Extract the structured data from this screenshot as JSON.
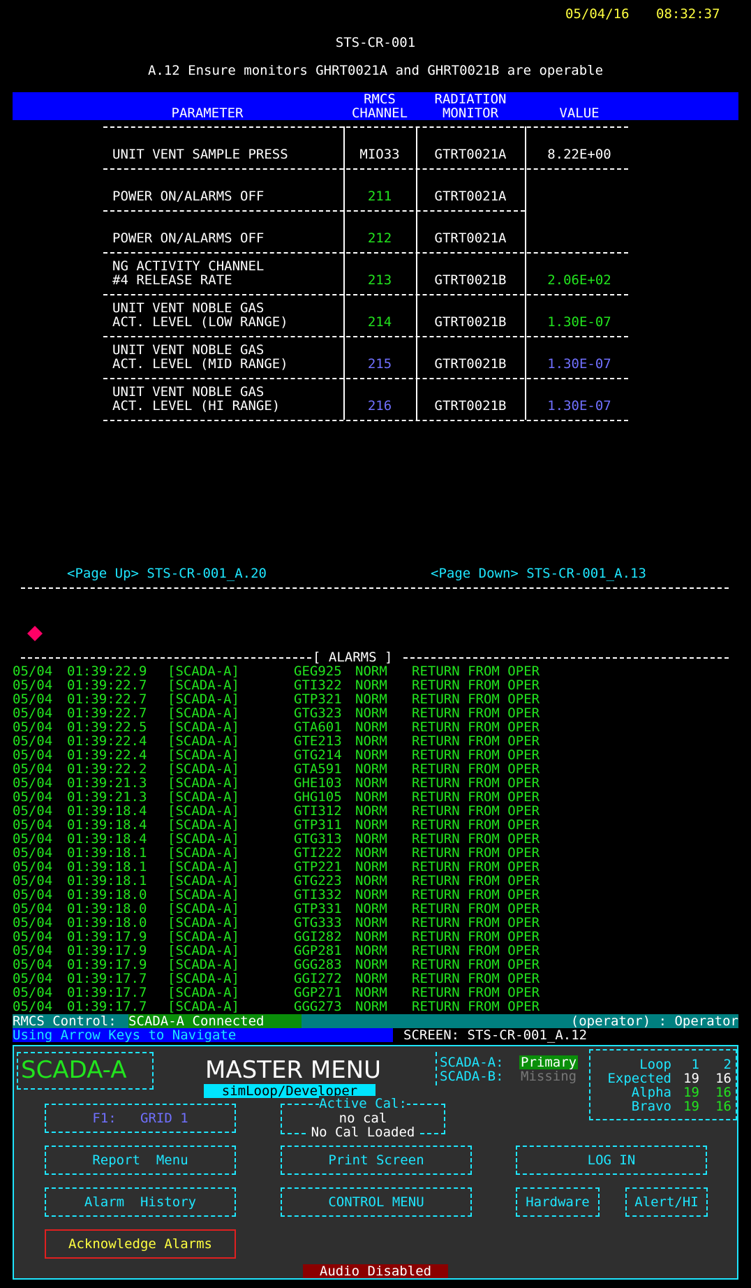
{
  "datetime": {
    "date": "05/04/16",
    "time": "08:32:37"
  },
  "screen_id": "STS-CR-001",
  "subtitle": "A.12 Ensure monitors GHRT0021A and GHRT0021B are operable",
  "table": {
    "headers": {
      "parameter": "PARAMETER",
      "rmcs_line1": "RMCS",
      "rmcs_line2": "CHANNEL",
      "rad_line1": "RADIATION",
      "rad_line2": "MONITOR",
      "value": "VALUE"
    },
    "rows": [
      {
        "param1": "UNIT VENT SAMPLE PRESS",
        "param2": "",
        "channel": "MIO33",
        "monitor": "GTRT0021A",
        "value": "8.22E+00",
        "color": "#ffffff"
      },
      {
        "param1": "POWER ON/ALARMS OFF",
        "param2": "",
        "channel": "211",
        "monitor": "GTRT0021A",
        "value": "",
        "color": "#22e41e"
      },
      {
        "param1": "POWER ON/ALARMS OFF",
        "param2": "",
        "channel": "212",
        "monitor": "GTRT0021A",
        "value": "",
        "color": "#22e41e"
      },
      {
        "param1": "NG ACTIVITY CHANNEL",
        "param2": "#4 RELEASE RATE",
        "channel": "213",
        "monitor": "GTRT0021B",
        "value": "2.06E+02",
        "color": "#22e41e"
      },
      {
        "param1": "UNIT VENT NOBLE GAS",
        "param2": "ACT. LEVEL (LOW RANGE)",
        "channel": "214",
        "monitor": "GTRT0021B",
        "value": "1.30E-07",
        "color": "#22e41e"
      },
      {
        "param1": "UNIT VENT NOBLE GAS",
        "param2": "ACT. LEVEL (MID RANGE)",
        "channel": "215",
        "monitor": "GTRT0021B",
        "value": "1.30E-07",
        "color": "#7070ff"
      },
      {
        "param1": "UNIT VENT NOBLE GAS",
        "param2": "ACT. LEVEL (HI RANGE)",
        "channel": "216",
        "monitor": "GTRT0021B",
        "value": "1.30E-07",
        "color": "#7070ff"
      }
    ]
  },
  "paging": {
    "page_up_key": "<Page Up>",
    "page_up_target": "STS-CR-001_A.20",
    "page_down_key": "<Page Down>",
    "page_down_target": "STS-CR-001_A.13"
  },
  "alarms": {
    "title": "[ ALARMS ]",
    "rows": [
      {
        "date": "05/04",
        "time": "01:39:22.9",
        "source": "[SCADA-A]",
        "point": "GEG925",
        "state": "NORM",
        "msg": "RETURN FROM OPER"
      },
      {
        "date": "05/04",
        "time": "01:39:22.7",
        "source": "[SCADA-A]",
        "point": "GTI322",
        "state": "NORM",
        "msg": "RETURN FROM OPER"
      },
      {
        "date": "05/04",
        "time": "01:39:22.7",
        "source": "[SCADA-A]",
        "point": "GTP321",
        "state": "NORM",
        "msg": "RETURN FROM OPER"
      },
      {
        "date": "05/04",
        "time": "01:39:22.7",
        "source": "[SCADA-A]",
        "point": "GTG323",
        "state": "NORM",
        "msg": "RETURN FROM OPER"
      },
      {
        "date": "05/04",
        "time": "01:39:22.5",
        "source": "[SCADA-A]",
        "point": "GTA601",
        "state": "NORM",
        "msg": "RETURN FROM OPER"
      },
      {
        "date": "05/04",
        "time": "01:39:22.4",
        "source": "[SCADA-A]",
        "point": "GTE213",
        "state": "NORM",
        "msg": "RETURN FROM OPER"
      },
      {
        "date": "05/04",
        "time": "01:39:22.4",
        "source": "[SCADA-A]",
        "point": "GTG214",
        "state": "NORM",
        "msg": "RETURN FROM OPER"
      },
      {
        "date": "05/04",
        "time": "01:39:22.2",
        "source": "[SCADA-A]",
        "point": "GTA591",
        "state": "NORM",
        "msg": "RETURN FROM OPER"
      },
      {
        "date": "05/04",
        "time": "01:39:21.3",
        "source": "[SCADA-A]",
        "point": "GHE103",
        "state": "NORM",
        "msg": "RETURN FROM OPER"
      },
      {
        "date": "05/04",
        "time": "01:39:21.3",
        "source": "[SCADA-A]",
        "point": "GHG105",
        "state": "NORM",
        "msg": "RETURN FROM OPER"
      },
      {
        "date": "05/04",
        "time": "01:39:18.4",
        "source": "[SCADA-A]",
        "point": "GTI312",
        "state": "NORM",
        "msg": "RETURN FROM OPER"
      },
      {
        "date": "05/04",
        "time": "01:39:18.4",
        "source": "[SCADA-A]",
        "point": "GTP311",
        "state": "NORM",
        "msg": "RETURN FROM OPER"
      },
      {
        "date": "05/04",
        "time": "01:39:18.4",
        "source": "[SCADA-A]",
        "point": "GTG313",
        "state": "NORM",
        "msg": "RETURN FROM OPER"
      },
      {
        "date": "05/04",
        "time": "01:39:18.1",
        "source": "[SCADA-A]",
        "point": "GTI222",
        "state": "NORM",
        "msg": "RETURN FROM OPER"
      },
      {
        "date": "05/04",
        "time": "01:39:18.1",
        "source": "[SCADA-A]",
        "point": "GTP221",
        "state": "NORM",
        "msg": "RETURN FROM OPER"
      },
      {
        "date": "05/04",
        "time": "01:39:18.1",
        "source": "[SCADA-A]",
        "point": "GTG223",
        "state": "NORM",
        "msg": "RETURN FROM OPER"
      },
      {
        "date": "05/04",
        "time": "01:39:18.0",
        "source": "[SCADA-A]",
        "point": "GTI332",
        "state": "NORM",
        "msg": "RETURN FROM OPER"
      },
      {
        "date": "05/04",
        "time": "01:39:18.0",
        "source": "[SCADA-A]",
        "point": "GTP331",
        "state": "NORM",
        "msg": "RETURN FROM OPER"
      },
      {
        "date": "05/04",
        "time": "01:39:18.0",
        "source": "[SCADA-A]",
        "point": "GTG333",
        "state": "NORM",
        "msg": "RETURN FROM OPER"
      },
      {
        "date": "05/04",
        "time": "01:39:17.9",
        "source": "[SCADA-A]",
        "point": "GGI282",
        "state": "NORM",
        "msg": "RETURN FROM OPER"
      },
      {
        "date": "05/04",
        "time": "01:39:17.9",
        "source": "[SCADA-A]",
        "point": "GGP281",
        "state": "NORM",
        "msg": "RETURN FROM OPER"
      },
      {
        "date": "05/04",
        "time": "01:39:17.9",
        "source": "[SCADA-A]",
        "point": "GGG283",
        "state": "NORM",
        "msg": "RETURN FROM OPER"
      },
      {
        "date": "05/04",
        "time": "01:39:17.7",
        "source": "[SCADA-A]",
        "point": "GGI272",
        "state": "NORM",
        "msg": "RETURN FROM OPER"
      },
      {
        "date": "05/04",
        "time": "01:39:17.7",
        "source": "[SCADA-A]",
        "point": "GGP271",
        "state": "NORM",
        "msg": "RETURN FROM OPER"
      },
      {
        "date": "05/04",
        "time": "01:39:17.7",
        "source": "[SCADA-A]",
        "point": "GGG273",
        "state": "NORM",
        "msg": "RETURN FROM OPER"
      }
    ]
  },
  "status": {
    "rmcs_label": "RMCS Control:",
    "rmcs_value": "SCADA-A Connected",
    "user": "(operator) : Operator",
    "nav_hint": "Using Arrow Keys to Navigate",
    "screen_label": "SCREEN: STS-CR-001_A.12"
  },
  "panel": {
    "system_name": "SCADA-A",
    "title": "MASTER MENU",
    "mode": "simLoop/Developer",
    "scada_a_label": "SCADA-A:",
    "scada_a_value": "Primary",
    "scada_b_label": "SCADA-B:",
    "scada_b_value": "Missing",
    "loop": {
      "loop_label": "Loop",
      "loop_1": "1",
      "loop_2": "2",
      "expected_label": "Expected",
      "expected_1": "19",
      "expected_2": "16",
      "alpha_label": "Alpha",
      "alpha_1": "19",
      "alpha_2": "16",
      "bravo_label": "Bravo",
      "bravo_1": "19",
      "bravo_2": "16"
    },
    "active_cal_label": "Active Cal:",
    "active_cal_value": "no cal",
    "cal_status": "No Cal Loaded",
    "buttons": {
      "f1_key": "F1:",
      "f1_value": "GRID 1",
      "report_menu": "Report  Menu",
      "print_screen": "Print Screen",
      "log_in": "LOG IN",
      "alarm_history": "Alarm  History",
      "control_menu": "CONTROL MENU",
      "hardware": "Hardware",
      "alert_hi": "Alert/HI",
      "acknowledge_alarms": "Acknowledge Alarms"
    },
    "audio_status": "Audio Disabled"
  },
  "colors": {
    "header_bar": "#0000ff",
    "ok_green": "#22e41e",
    "accent_cyan": "#1ee6ff",
    "date_yellow": "#ffff40",
    "status_teal": "#008080",
    "alarm_marker": "#ff0066"
  }
}
